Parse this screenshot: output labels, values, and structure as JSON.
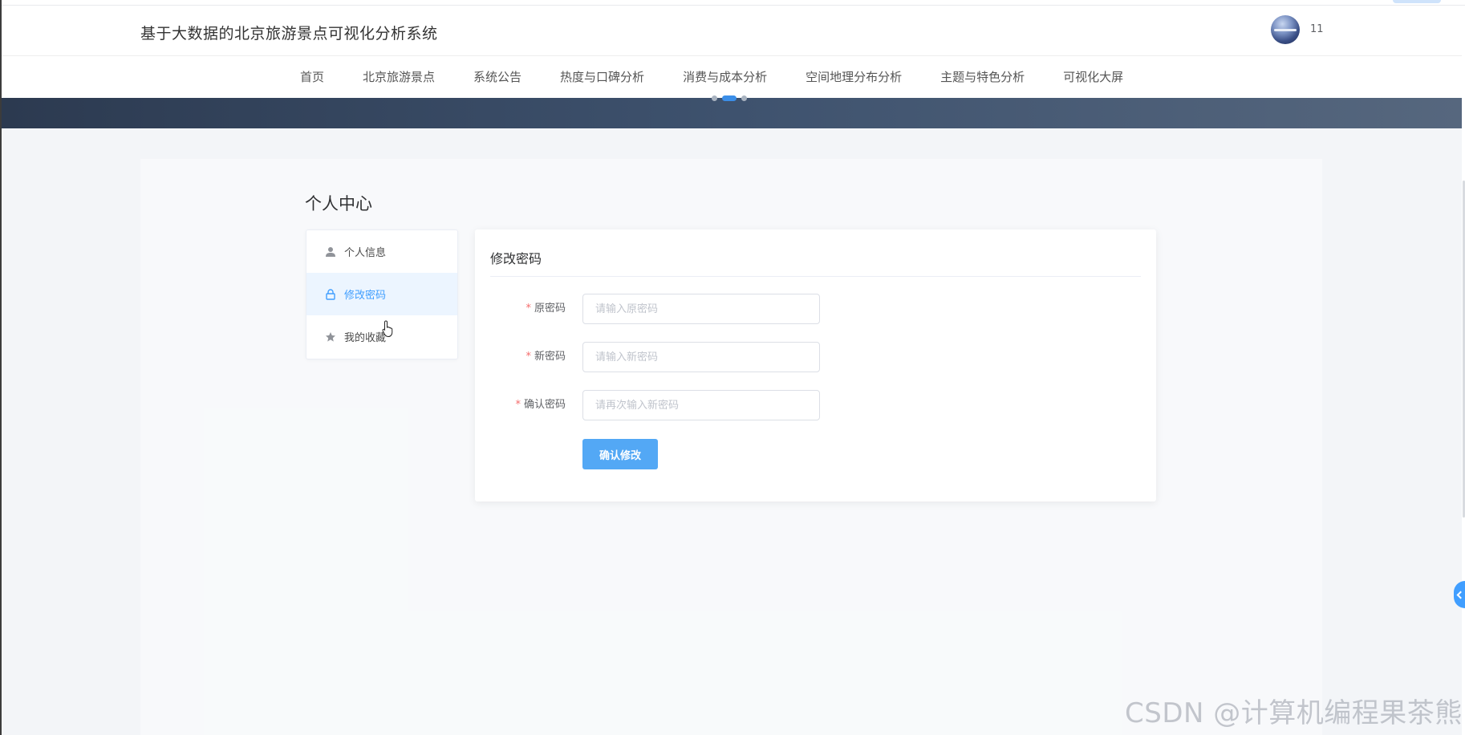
{
  "header": {
    "site_title": "基于大数据的北京旅游景点可视化分析系统",
    "username": "11"
  },
  "nav": {
    "items": [
      {
        "label": "首页"
      },
      {
        "label": "北京旅游景点"
      },
      {
        "label": "系统公告"
      },
      {
        "label": "热度与口碑分析"
      },
      {
        "label": "消费与成本分析"
      },
      {
        "label": "空间地理分布分析"
      },
      {
        "label": "主题与特色分析"
      },
      {
        "label": "可视化大屏"
      }
    ]
  },
  "banner": {
    "carousel_active_index": 1,
    "carousel_count": 3
  },
  "page": {
    "heading": "个人中心"
  },
  "side_menu": {
    "items": [
      {
        "label": "个人信息",
        "icon": "user-icon"
      },
      {
        "label": "修改密码",
        "icon": "lock-icon",
        "active": true
      },
      {
        "label": "我的收藏",
        "icon": "star-icon"
      }
    ]
  },
  "form": {
    "title": "修改密码",
    "fields": [
      {
        "label": "原密码",
        "required": true,
        "value": "",
        "placeholder": "请输入原密码"
      },
      {
        "label": "新密码",
        "required": true,
        "value": "",
        "placeholder": "请输入新密码"
      },
      {
        "label": "确认密码",
        "required": true,
        "value": "",
        "placeholder": "请再次输入新密码"
      }
    ],
    "submit_label": "确认修改"
  },
  "watermark": "CSDN @计算机编程果茶熊",
  "colors": {
    "accent": "#409eff",
    "button": "#53a8f5",
    "required": "#f56c6c",
    "active_menu_bg": "#ecf5ff"
  }
}
